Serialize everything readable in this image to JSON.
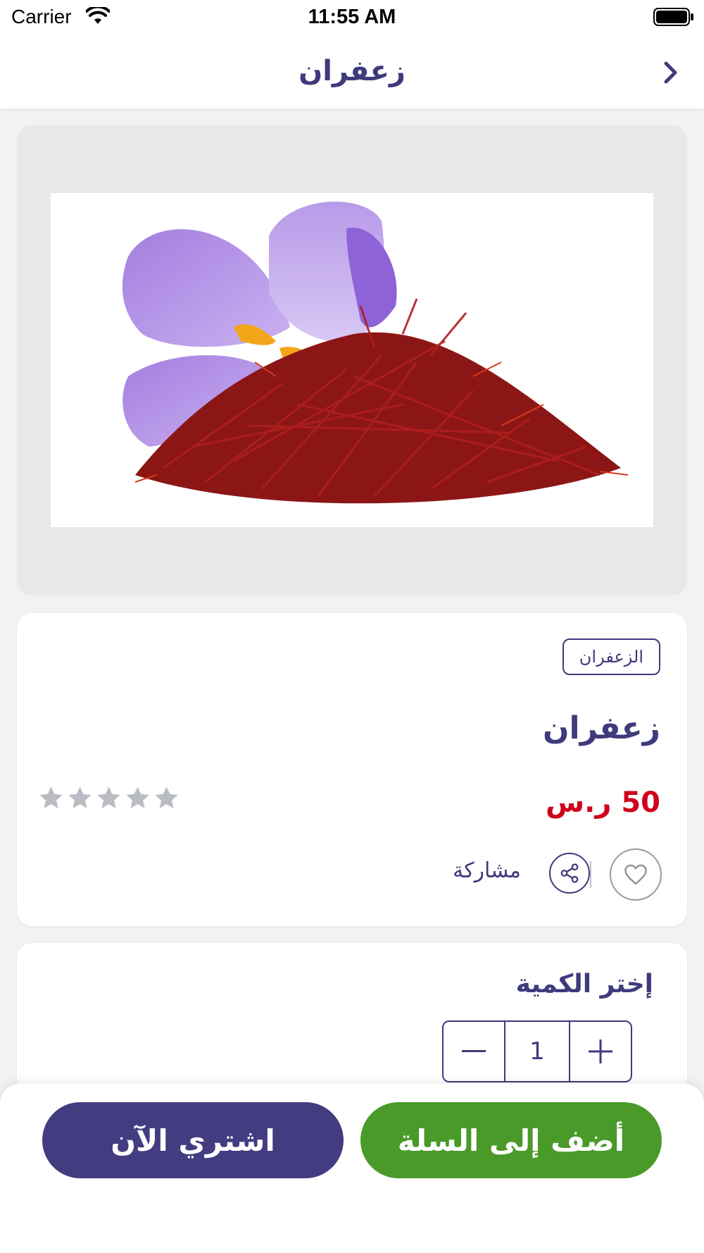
{
  "status_bar": {
    "carrier": "Carrier",
    "time": "11:55 AM"
  },
  "header": {
    "title": "زعفران",
    "back_icon": "chevron-right-icon"
  },
  "product": {
    "image_alt_icon": "saffron-flower-image",
    "category": "الزعفران",
    "name": "زعفران",
    "price": "50 ر.س",
    "rating": {
      "value": 0,
      "max": 5
    },
    "share_label": "مشاركة"
  },
  "quantity": {
    "label": "إختر الكمية",
    "value": "1"
  },
  "actions": {
    "buy_now": "اشتري الآن",
    "add_to_cart": "أضف إلى السلة"
  },
  "colors": {
    "primary": "#3f3a7c",
    "price": "#d0021b",
    "add_to_cart": "#4a9a2a",
    "buy_now": "#433c80",
    "star_inactive": "#b9bcc2"
  }
}
